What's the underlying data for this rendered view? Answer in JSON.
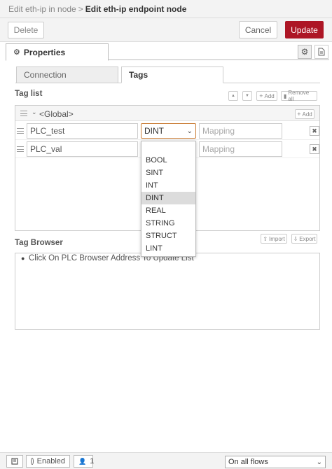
{
  "breadcrumb": {
    "parent": "Edit eth-ip in node",
    "separator": ">",
    "current": "Edit eth-ip endpoint node"
  },
  "toolbar": {
    "delete_label": "Delete",
    "cancel_label": "Cancel",
    "update_label": "Update"
  },
  "tabs": {
    "properties_label": "Properties"
  },
  "subtabs": {
    "connection_label": "Connection",
    "tags_label": "Tags"
  },
  "taglist": {
    "title": "Tag list",
    "up_label": "▲",
    "down_label": "▼",
    "add_label": "Add",
    "remove_all_label": "Remove all",
    "group_label": "<Global>",
    "group_add_label": "Add",
    "rows": [
      {
        "name": "PLC_test",
        "type": "DINT",
        "mapping_placeholder": "Mapping"
      },
      {
        "name": "PLC_val",
        "type": "",
        "mapping_placeholder": "Mapping"
      }
    ]
  },
  "dropdown": {
    "options": [
      "BOOL",
      "SINT",
      "INT",
      "DINT",
      "REAL",
      "STRING",
      "STRUCT",
      "LINT"
    ],
    "selected": "DINT"
  },
  "browser": {
    "title": "Tag Browser",
    "import_label": "Import",
    "export_label": "Export",
    "hint": "Click On PLC Browser Address To Update List"
  },
  "footer": {
    "enabled_label": "Enabled",
    "user_count": "1",
    "flows_select": "On all flows"
  }
}
